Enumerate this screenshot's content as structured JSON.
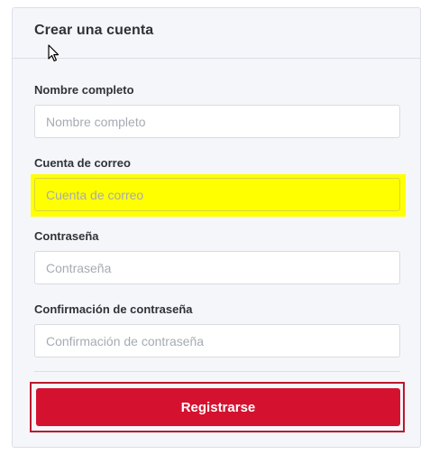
{
  "form": {
    "title": "Crear una cuenta",
    "fields": [
      {
        "label": "Nombre completo",
        "placeholder": "Nombre completo",
        "value": "",
        "highlighted": false
      },
      {
        "label": "Cuenta de correo",
        "placeholder": "Cuenta de correo",
        "value": "",
        "highlighted": true
      },
      {
        "label": "Contraseña",
        "placeholder": "Contraseña",
        "value": "",
        "highlighted": false
      },
      {
        "label": "Confirmación de contraseña",
        "placeholder": "Confirmación de contraseña",
        "value": "",
        "highlighted": false
      }
    ],
    "submit_label": "Registrarse"
  },
  "colors": {
    "panel_background": "#f5f6fa",
    "primary_button": "#d4122f",
    "highlight": "#ffff00"
  },
  "icons": {
    "cursor": "mouse-pointer-icon"
  }
}
